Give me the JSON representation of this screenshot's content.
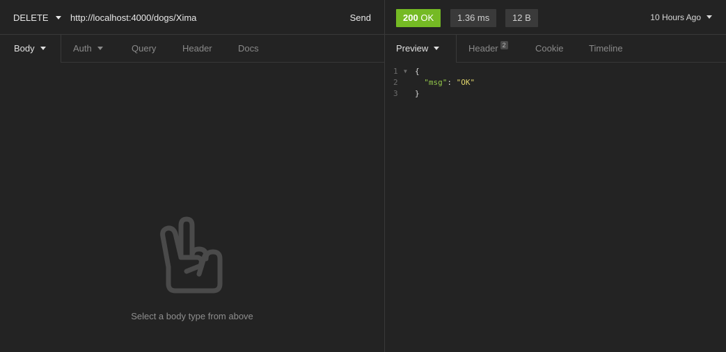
{
  "request": {
    "method": "DELETE",
    "url": "http://localhost:4000/dogs/Xima",
    "send_label": "Send",
    "tabs": [
      {
        "label": "Body"
      },
      {
        "label": "Auth"
      },
      {
        "label": "Query"
      },
      {
        "label": "Header"
      },
      {
        "label": "Docs"
      }
    ],
    "empty_message": "Select a body type from above"
  },
  "response": {
    "status_code": "200",
    "status_text": "OK",
    "time": "1.36 ms",
    "size": "12 B",
    "history": "10 Hours Ago",
    "tabs": [
      {
        "label": "Preview"
      },
      {
        "label": "Header",
        "count": "2"
      },
      {
        "label": "Cookie"
      },
      {
        "label": "Timeline"
      }
    ],
    "lines": [
      {
        "num": "1",
        "open": "{"
      },
      {
        "num": "2",
        "key": "\"msg\"",
        "colon": ": ",
        "value": "\"OK\""
      },
      {
        "num": "3",
        "close": "}"
      }
    ]
  },
  "colors": {
    "status_ok": "#75ba24",
    "json_key": "#93c74a",
    "json_string": "#e0d56b",
    "background": "#232323"
  }
}
